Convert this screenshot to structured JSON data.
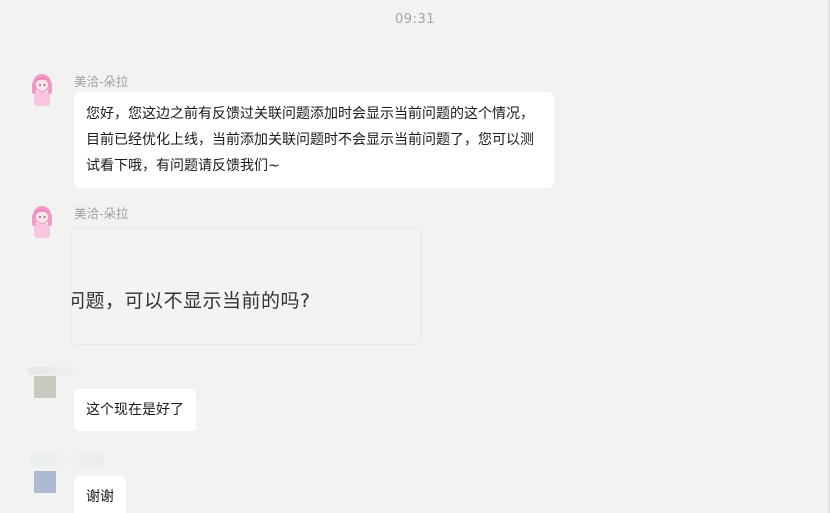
{
  "timestamp": "09:31",
  "messages": [
    {
      "sender": "美洽-朵拉",
      "text": "您好，您这边之前有反馈过关联问题添加时会显示当前问题的这个情况，目前已经优化上线，当前添加关联问题时不会显示当前问题了，您可以测试看下哦，有问题请反馈我们~"
    },
    {
      "sender": "美洽-朵拉",
      "image_text": "问题，可以不显示当前的吗?"
    },
    {
      "text": "这个现在是好了"
    },
    {
      "text": "谢谢"
    }
  ],
  "icons": {
    "agent_avatar": "pink-haired-girl-avatar",
    "user_avatar": "blurred-avatar"
  },
  "colors": {
    "background": "#f2f2f2",
    "bubble": "#ffffff",
    "timestamp": "#a6a6a6",
    "sender_name": "#a0a0a0",
    "avatar_pink": "#f2a0c8"
  }
}
